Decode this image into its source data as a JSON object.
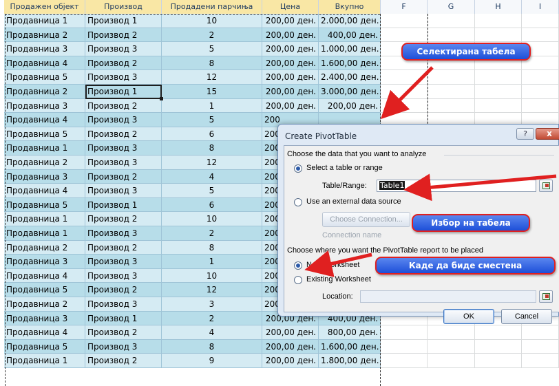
{
  "column_headers": [
    "Продажен објект",
    "Производ",
    "Продадени парчиња",
    "Цена",
    "Вкупно",
    "F",
    "G",
    "H",
    "I"
  ],
  "rows": [
    [
      "Продавница 1",
      "Производ 1",
      "10",
      "200,00 ден.",
      "2.000,00 ден."
    ],
    [
      "Продавница 2",
      "Производ 2",
      "2",
      "200,00 ден.",
      "400,00 ден."
    ],
    [
      "Продавница 3",
      "Производ 3",
      "5",
      "200,00 ден.",
      "1.000,00 ден."
    ],
    [
      "Продавница 4",
      "Производ 2",
      "8",
      "200,00 ден.",
      "1.600,00 ден."
    ],
    [
      "Продавница 5",
      "Производ 3",
      "12",
      "200,00 ден.",
      "2.400,00 ден."
    ],
    [
      "Продавница 2",
      "Производ 1",
      "15",
      "200,00 ден.",
      "3.000,00 ден."
    ],
    [
      "Продавница 3",
      "Производ 2",
      "1",
      "200,00 ден.",
      "200,00 ден."
    ],
    [
      "Продавница 4",
      "Производ 3",
      "5",
      "200",
      ""
    ],
    [
      "Продавница 5",
      "Производ 2",
      "6",
      "200",
      ""
    ],
    [
      "Продавница 1",
      "Производ 3",
      "8",
      "200",
      ""
    ],
    [
      "Продавница 2",
      "Производ 3",
      "12",
      "200",
      ""
    ],
    [
      "Продавница 3",
      "Производ 2",
      "4",
      "200",
      ""
    ],
    [
      "Продавница 4",
      "Производ 3",
      "5",
      "200",
      ""
    ],
    [
      "Продавница 5",
      "Производ 1",
      "6",
      "200",
      ""
    ],
    [
      "Продавница 1",
      "Производ 2",
      "10",
      "200",
      ""
    ],
    [
      "Продавница 1",
      "Производ 3",
      "2",
      "200",
      ""
    ],
    [
      "Продавница 2",
      "Производ 2",
      "8",
      "200",
      ""
    ],
    [
      "Продавница 3",
      "Производ 3",
      "1",
      "200",
      ""
    ],
    [
      "Продавница 4",
      "Производ 3",
      "10",
      "200",
      ""
    ],
    [
      "Продавница 5",
      "Производ 2",
      "12",
      "200",
      ""
    ],
    [
      "Продавница 2",
      "Производ 3",
      "3",
      "200",
      ""
    ],
    [
      "Продавница 3",
      "Производ 1",
      "2",
      "200,00 ден.",
      "400,00 ден."
    ],
    [
      "Продавница 4",
      "Производ 2",
      "4",
      "200,00 ден.",
      "800,00 ден."
    ],
    [
      "Продавница 5",
      "Производ 3",
      "8",
      "200,00 ден.",
      "1.600,00 ден."
    ],
    [
      "Продавница 1",
      "Производ 2",
      "9",
      "200,00 ден.",
      "1.800,00 ден."
    ]
  ],
  "dialog": {
    "title": "Create PivotTable",
    "help_label": "?",
    "close_label": "x",
    "section1": "Choose the data that you want to analyze",
    "opt_select_range": "Select a table or range",
    "table_range_label": "Table/Range:",
    "table_range_value": "Table1",
    "opt_external": "Use an external data source",
    "choose_connection": "Choose Connection...",
    "connection_name_label": "Connection name",
    "section2": "Choose where you want the PivotTable report to be placed",
    "opt_new_ws": "New Worksheet",
    "opt_existing_ws": "Existing Worksheet",
    "location_label": "Location:",
    "location_value": "",
    "ok_label": "OK",
    "cancel_label": "Cancel"
  },
  "callouts": {
    "selected_table": "Селектирана табела",
    "table_choice": "Избор на табела",
    "placement": "Каде да биде сместена"
  },
  "colors": {
    "band_light": "#d5ebf3",
    "band_dark": "#b7dde9",
    "callout_fill": "#1d4fd8",
    "callout_border": "#e02020",
    "arrow": "#e02020"
  }
}
